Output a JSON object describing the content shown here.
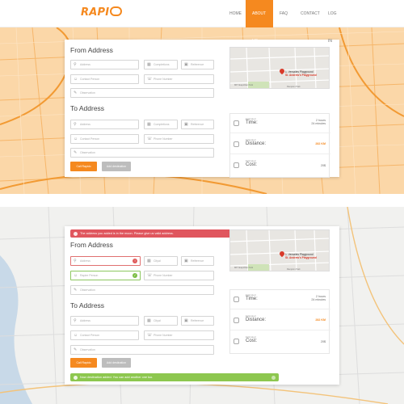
{
  "header": {
    "logo_text": "RAPI",
    "nav": [
      "HOME",
      "ABOUT US",
      "FAQ",
      "CONTACT",
      "LOG IN"
    ]
  },
  "colors": {
    "accent": "#f5891f",
    "error": "#e0565e",
    "success": "#8dc74f"
  },
  "form1": {
    "from_title": "From Address",
    "to_title": "To Address",
    "from": {
      "address": "Address",
      "city": "Completions",
      "reference": "Reference",
      "contact": "Contact Person",
      "phone": "Phone Number",
      "observation": "Observation"
    },
    "to": {
      "address": "Address",
      "city": "Completions",
      "reference": "Reference",
      "contact": "Contact Person",
      "phone": "Phone Number",
      "observation": "Observation"
    },
    "call_button": "Call Rapido",
    "add_button": "Add destination"
  },
  "form2": {
    "alert_error": "The address you added is in the moon. Please give us valid address.",
    "alert_success": "Now destination added. You can add another one too.",
    "from_title": "From Address",
    "to_title": "To Address",
    "from": {
      "address": "Address",
      "city": "Cityal",
      "reference": "Reference",
      "contact": "Rapier Person",
      "phone": "Phone Number",
      "observation": "Observation"
    },
    "to": {
      "address": "Address",
      "city": "Cityal",
      "reference": "Reference",
      "contact": "Contact Person",
      "phone": "Phone Number",
      "observation": "Observation"
    },
    "call_button": "Call Rapido",
    "add_button": "Add destination"
  },
  "map_panel": {
    "pin1": "1. Versailes Playground",
    "pin2": "St. Andrew's Playground",
    "street1": "MP Neapolitan Park",
    "street2": "Rampton Park"
  },
  "stats": {
    "time": {
      "label": "Estimated",
      "name": "Time:",
      "value_line1": "2 hours",
      "value_line2": "24 minutes"
    },
    "distance": {
      "label": "Estimated",
      "name": "Distance:",
      "value": "282 KM"
    },
    "cost": {
      "label": "Estimated",
      "name": "Cost:",
      "value": "20$"
    }
  }
}
